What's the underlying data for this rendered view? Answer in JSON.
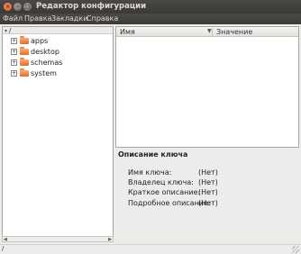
{
  "window": {
    "title": "Редактор конфигурации"
  },
  "menubar": {
    "items": [
      "Файл",
      "Правка",
      "Закладки",
      "Справка"
    ]
  },
  "tree": {
    "root_label": "/",
    "items": [
      {
        "label": "apps",
        "expander": "+"
      },
      {
        "label": "desktop",
        "expander": "+"
      },
      {
        "label": "schemas",
        "expander": "+"
      },
      {
        "label": "system",
        "expander": "+"
      }
    ]
  },
  "keys": {
    "col_name": "Имя",
    "col_value": "Значение",
    "sort_indicator": "▼"
  },
  "description": {
    "title": "Описание ключа",
    "rows": [
      {
        "label": "Имя ключа:",
        "value": "(Нет)"
      },
      {
        "label": "Владелец ключа:",
        "value": "(Нет)"
      },
      {
        "label": "Краткое описание:",
        "value": "(Нет)"
      },
      {
        "label": "Подробное описание:",
        "value": "(Нет)"
      }
    ]
  },
  "statusbar": {
    "path": "/"
  },
  "colors": {
    "titlebar": "#3c3b37",
    "close_button": "#e05a24",
    "folder": "#e06b2a"
  },
  "icons": {
    "close": "close-icon",
    "minimize": "minimize-icon",
    "maximize": "maximize-icon",
    "folder": "folder-icon"
  }
}
